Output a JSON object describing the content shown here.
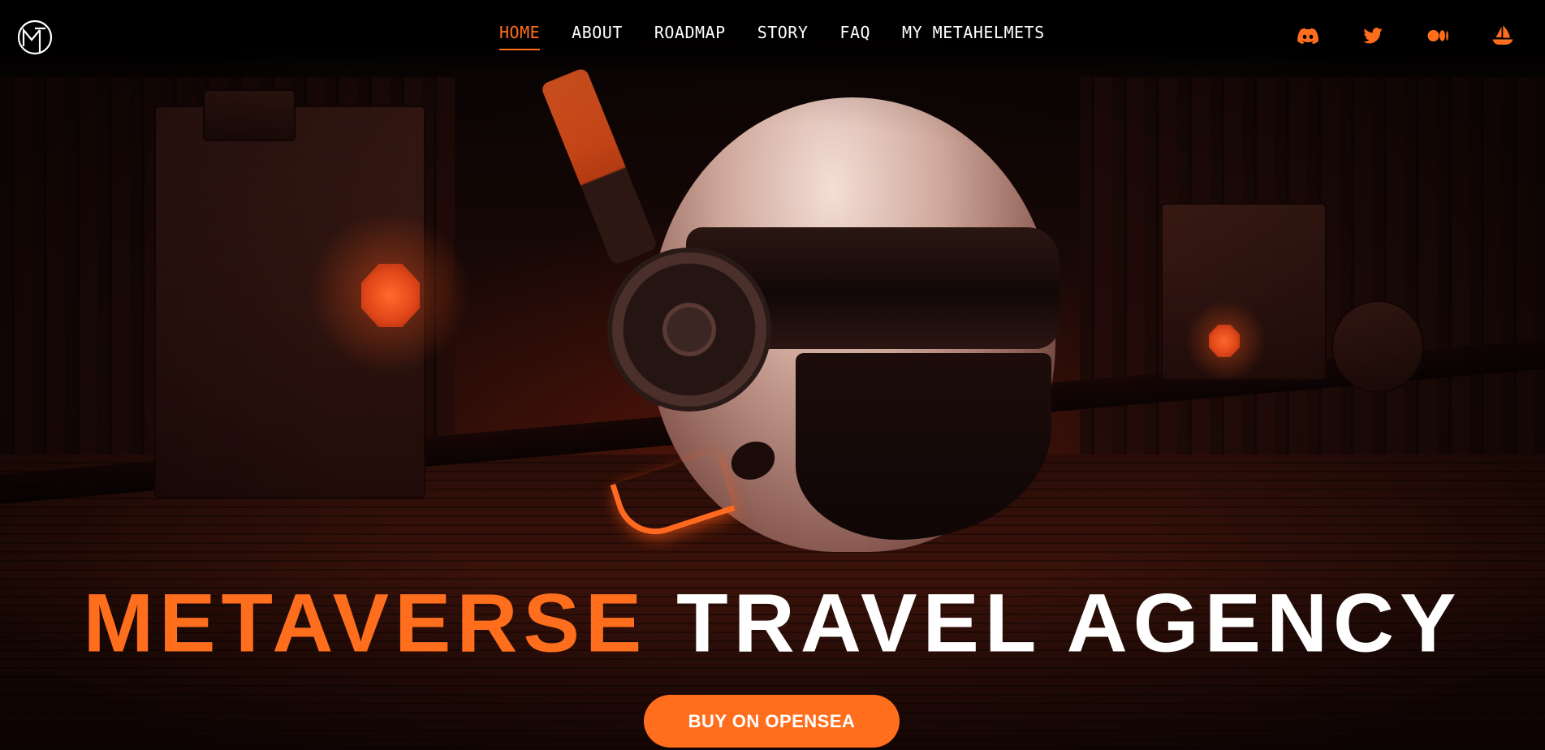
{
  "nav": {
    "items": [
      {
        "label": "HOME",
        "active": true
      },
      {
        "label": "ABOUT",
        "active": false
      },
      {
        "label": "ROADMAP",
        "active": false
      },
      {
        "label": "STORY",
        "active": false
      },
      {
        "label": "FAQ",
        "active": false
      },
      {
        "label": "MY METAHELMETS",
        "active": false
      }
    ]
  },
  "socials": [
    {
      "icon": "discord-icon"
    },
    {
      "icon": "twitter-icon"
    },
    {
      "icon": "medium-icon"
    },
    {
      "icon": "opensea-icon"
    }
  ],
  "hero": {
    "title_part1": "METAVERSE",
    "title_part2": "TRAVEL AGENCY",
    "cta_label": "BUY ON OPENSEA"
  },
  "colors": {
    "accent": "#ff6e1d",
    "text": "#ffffff",
    "background": "#050303"
  }
}
